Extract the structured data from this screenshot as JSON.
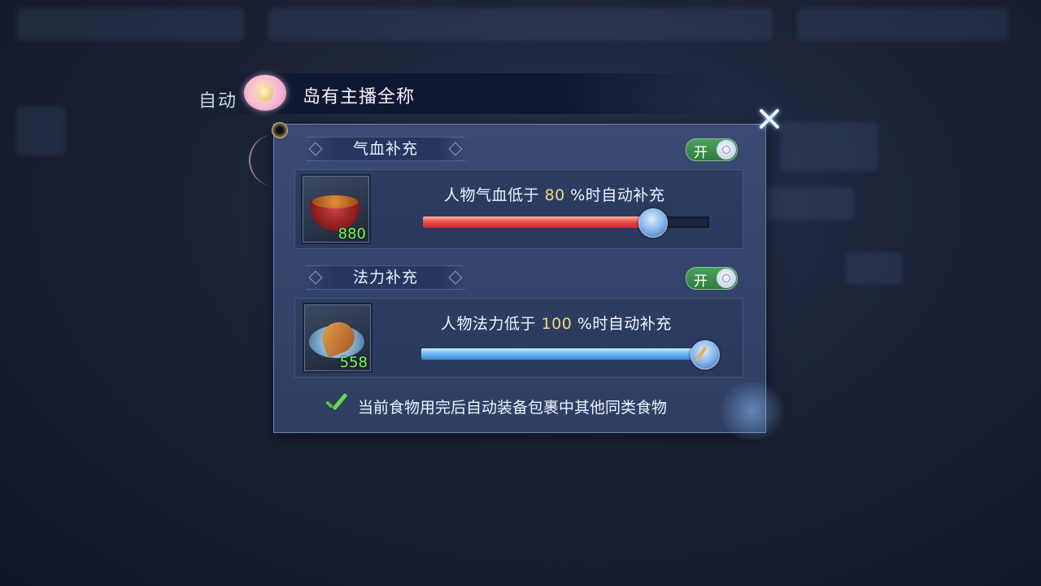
{
  "header": {
    "title": "自动",
    "streamer_name": "岛有主播全称"
  },
  "sections": [
    {
      "title": "气血补充",
      "toggle_label": "开",
      "toggle_on": true,
      "item": {
        "icon": "soup-pot-icon",
        "quantity": "880"
      },
      "label_prefix": "人物气血低于",
      "threshold": "80",
      "label_suffix": "%时自动补充",
      "slider_fraction": 0.8,
      "slider_color": "#e84b45"
    },
    {
      "title": "法力补充",
      "toggle_label": "开",
      "toggle_on": true,
      "item": {
        "icon": "fish-plate-icon",
        "quantity": "558"
      },
      "label_prefix": "人物法力低于",
      "threshold": "100",
      "label_suffix": "%时自动补充",
      "slider_fraction": 1.0,
      "slider_color": "#6cbcf3"
    }
  ],
  "auto_equip": {
    "checked": true,
    "label": "当前食物用完后自动装备包裹中其他同类食物"
  }
}
